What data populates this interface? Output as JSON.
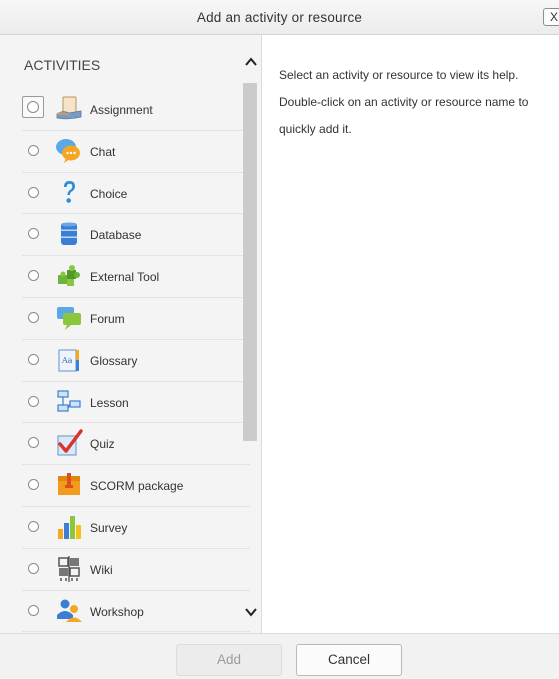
{
  "dialog": {
    "title": "Add an activity or resource",
    "close_label": "X"
  },
  "activities": {
    "heading": "ACTIVITIES",
    "items": [
      {
        "label": "Assignment",
        "icon": "assignment-icon"
      },
      {
        "label": "Chat",
        "icon": "chat-icon"
      },
      {
        "label": "Choice",
        "icon": "choice-icon"
      },
      {
        "label": "Database",
        "icon": "database-icon"
      },
      {
        "label": "External Tool",
        "icon": "external-tool-icon"
      },
      {
        "label": "Forum",
        "icon": "forum-icon"
      },
      {
        "label": "Glossary",
        "icon": "glossary-icon"
      },
      {
        "label": "Lesson",
        "icon": "lesson-icon"
      },
      {
        "label": "Quiz",
        "icon": "quiz-icon"
      },
      {
        "label": "SCORM package",
        "icon": "scorm-package-icon"
      },
      {
        "label": "Survey",
        "icon": "survey-icon"
      },
      {
        "label": "Wiki",
        "icon": "wiki-icon"
      },
      {
        "label": "Workshop",
        "icon": "workshop-icon"
      }
    ]
  },
  "help": {
    "text": "Select an activity or resource to view its help. Double-click on an activity or resource name to quickly add it."
  },
  "footer": {
    "add_label": "Add",
    "cancel_label": "Cancel"
  }
}
